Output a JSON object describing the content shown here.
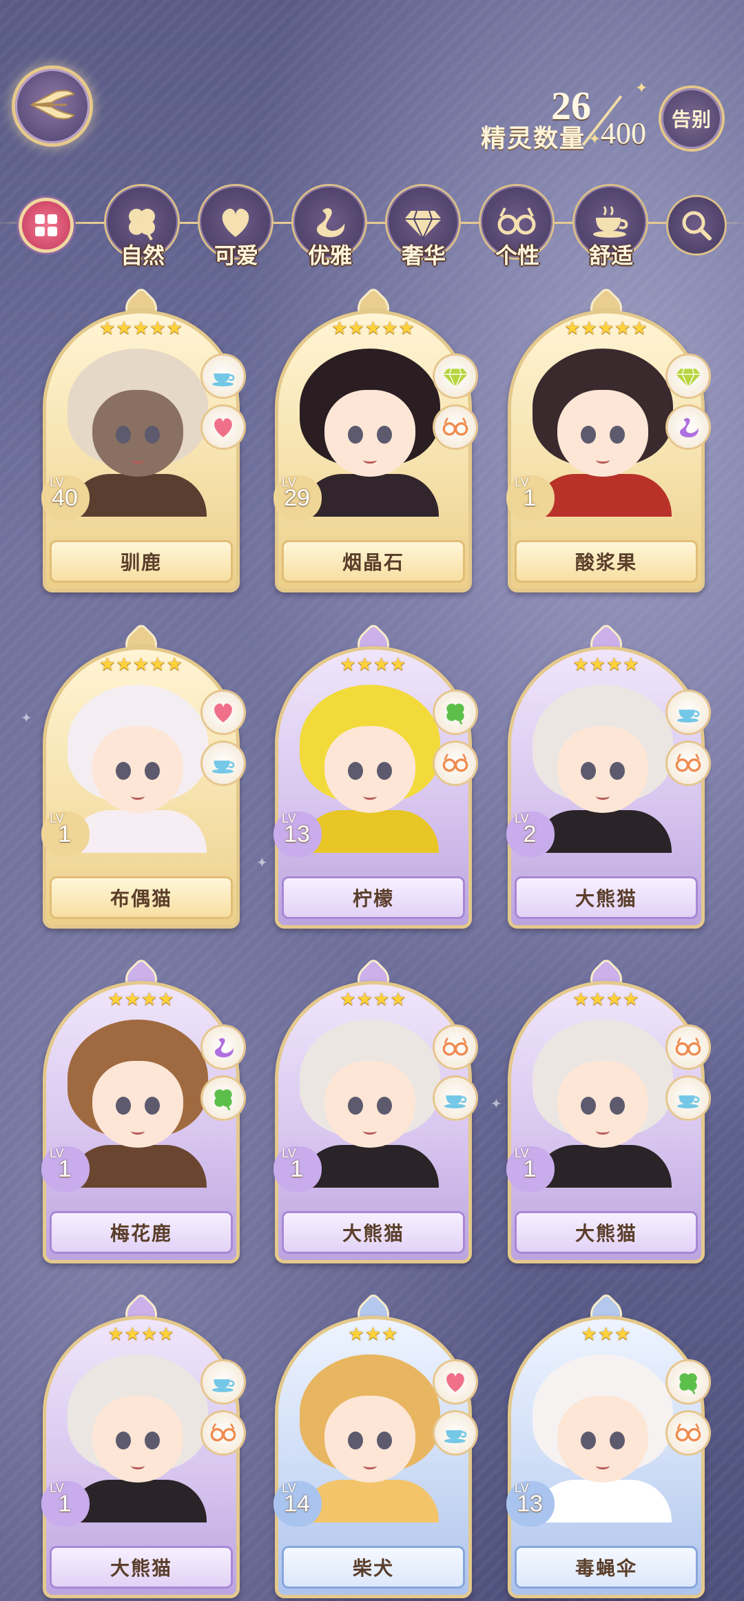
{
  "header": {
    "count_label": "精灵数量",
    "count_current": "26",
    "count_max": "400",
    "farewell_label": "告别"
  },
  "filters": [
    {
      "label": "自然",
      "icon": "clover-icon"
    },
    {
      "label": "可爱",
      "icon": "heart-icon"
    },
    {
      "label": "优雅",
      "icon": "swan-icon"
    },
    {
      "label": "奢华",
      "icon": "diamond-icon"
    },
    {
      "label": "个性",
      "icon": "glasses-icon"
    },
    {
      "label": "舒适",
      "icon": "teacup-icon"
    }
  ],
  "cards": [
    {
      "name": "驯鹿",
      "level": "40",
      "stars": "★★★★★",
      "rarity": "gold",
      "attrs": [
        "teacup-icon",
        "heart-icon"
      ]
    },
    {
      "name": "烟晶石",
      "level": "29",
      "stars": "★★★★★",
      "rarity": "gold",
      "attrs": [
        "diamond-icon",
        "glasses-icon"
      ]
    },
    {
      "name": "酸浆果",
      "level": "1",
      "stars": "★★★★★",
      "rarity": "gold",
      "attrs": [
        "diamond-icon",
        "swan-icon"
      ]
    },
    {
      "name": "布偶猫",
      "level": "1",
      "stars": "★★★★★",
      "rarity": "gold",
      "attrs": [
        "heart-icon",
        "teacup-icon"
      ]
    },
    {
      "name": "柠檬",
      "level": "13",
      "stars": "★★★★",
      "rarity": "purple",
      "attrs": [
        "clover-icon",
        "glasses-icon"
      ]
    },
    {
      "name": "大熊猫",
      "level": "2",
      "stars": "★★★★",
      "rarity": "purple",
      "attrs": [
        "teacup-icon",
        "glasses-icon"
      ]
    },
    {
      "name": "梅花鹿",
      "level": "1",
      "stars": "★★★★",
      "rarity": "purple",
      "attrs": [
        "swan-icon",
        "clover-icon"
      ]
    },
    {
      "name": "大熊猫",
      "level": "1",
      "stars": "★★★★",
      "rarity": "purple",
      "attrs": [
        "glasses-icon",
        "teacup-icon"
      ]
    },
    {
      "name": "大熊猫",
      "level": "1",
      "stars": "★★★★",
      "rarity": "purple",
      "attrs": [
        "glasses-icon",
        "teacup-icon"
      ]
    },
    {
      "name": "大熊猫",
      "level": "1",
      "stars": "★★★★",
      "rarity": "purple",
      "attrs": [
        "teacup-icon",
        "glasses-icon"
      ]
    },
    {
      "name": "柴犬",
      "level": "14",
      "stars": "★★★",
      "rarity": "blue",
      "attrs": [
        "heart-icon",
        "teacup-icon"
      ]
    },
    {
      "name": "毒蝇伞",
      "level": "13",
      "stars": "★★★",
      "rarity": "blue",
      "attrs": [
        "clover-icon",
        "glasses-icon"
      ]
    }
  ],
  "lv_prefix": "LV",
  "colors": {
    "accent_gold": "#e4c98c",
    "rarity_gold": "#f6e2ad",
    "rarity_purple": "#d8c6ef",
    "rarity_blue": "#cddcf6",
    "filter_all_active": "#d24a6a"
  }
}
